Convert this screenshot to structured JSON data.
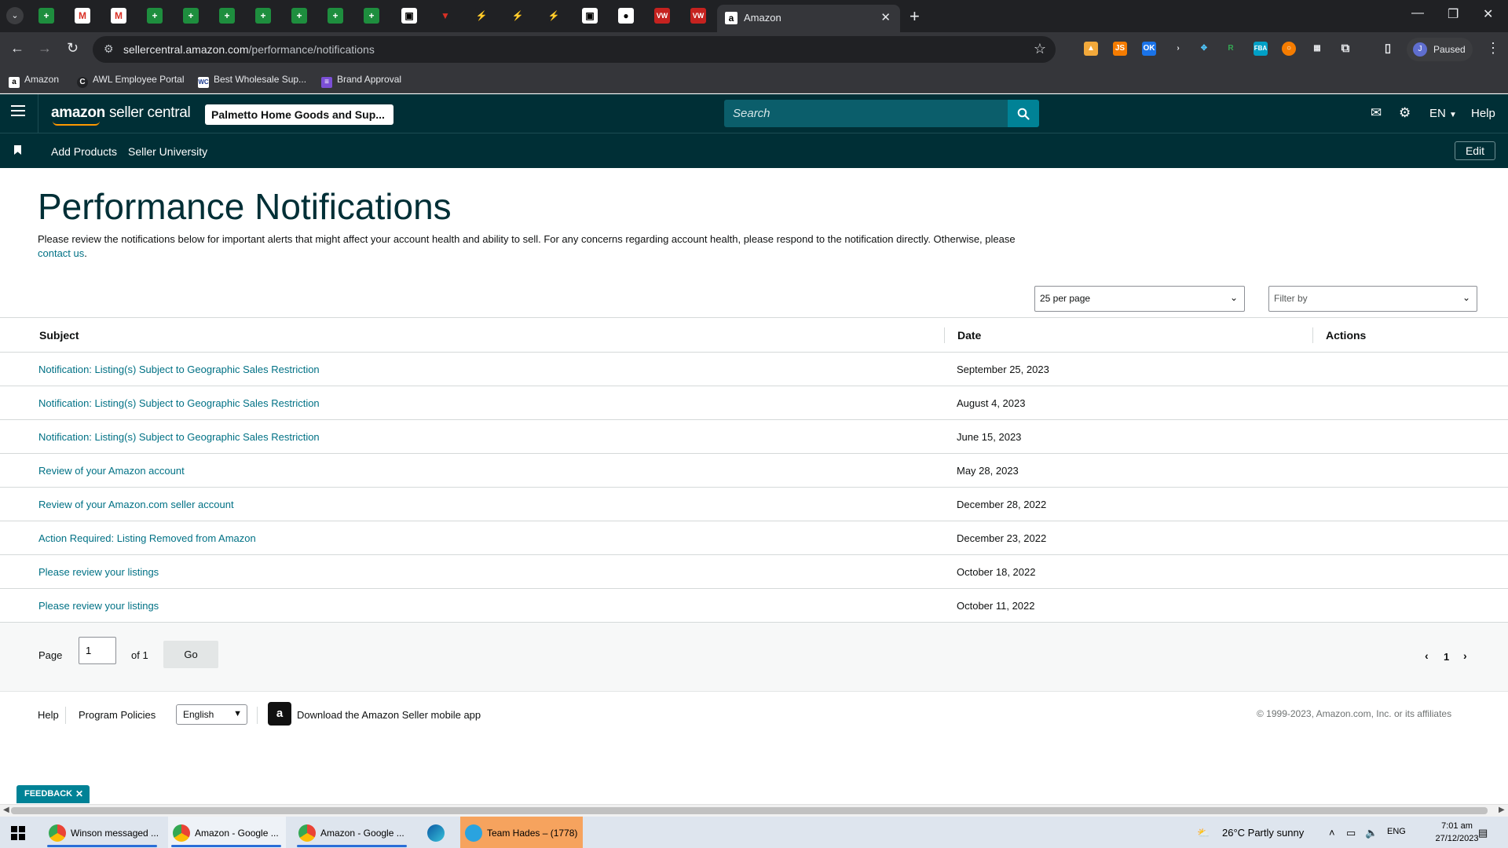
{
  "browser": {
    "active_tab_title": "Amazon",
    "url_domain": "sellercentral.amazon.com",
    "url_path": "/performance/notifications",
    "profile_label": "Paused",
    "profile_initial": "J",
    "bookmarks": [
      "Amazon",
      "AWL Employee Portal",
      "Best Wholesale Sup...",
      "Brand Approval"
    ]
  },
  "header": {
    "logo_brand": "amazon",
    "logo_product": "seller central",
    "store_name": "Palmetto Home Goods and Sup...",
    "search_placeholder": "Search",
    "language": "EN",
    "help": "Help"
  },
  "subnav": {
    "links": [
      "Add Products",
      "Seller University"
    ],
    "edit": "Edit"
  },
  "main": {
    "title": "Performance Notifications",
    "intro_text": "Please review the notifications below for important alerts that might affect your account health and ability to sell. For any concerns regarding account health, please respond to the notification directly. Otherwise, please ",
    "intro_link": "contact us",
    "intro_end": ".",
    "per_page": "25 per page",
    "filter_placeholder": "Filter by"
  },
  "table": {
    "columns": [
      "Subject",
      "Date",
      "Actions"
    ],
    "rows": [
      {
        "subject": "Notification: Listing(s) Subject to Geographic Sales Restriction",
        "date": "September 25, 2023"
      },
      {
        "subject": "Notification: Listing(s) Subject to Geographic Sales Restriction",
        "date": "August 4, 2023"
      },
      {
        "subject": "Notification: Listing(s) Subject to Geographic Sales Restriction",
        "date": "June 15, 2023"
      },
      {
        "subject": "Review of your Amazon account",
        "date": "May 28, 2023"
      },
      {
        "subject": "Review of your Amazon.com seller account",
        "date": "December 28, 2022"
      },
      {
        "subject": "Action Required: Listing Removed from Amazon",
        "date": "December 23, 2022"
      },
      {
        "subject": "Please review your listings",
        "date": "October 18, 2022"
      },
      {
        "subject": "Please review your listings",
        "date": "October 11, 2022"
      }
    ]
  },
  "pagination": {
    "page_label": "Page",
    "page_value": "1",
    "of_label": "of 1",
    "go": "Go",
    "current_page": "1"
  },
  "footer": {
    "help": "Help",
    "program_policies": "Program Policies",
    "language": "English",
    "app_download": "Download the Amazon Seller mobile app",
    "copyright": "© 1999-2023, Amazon.com, Inc. or its affiliates"
  },
  "feedback": "FEEDBACK",
  "taskbar": {
    "items": [
      "Winson messaged ...",
      "Amazon - Google ...",
      "Amazon - Google ...",
      "Team Hades – (1778)"
    ],
    "weather": "26°C  Partly sunny",
    "lang": "ENG",
    "time": "7:01 am",
    "date": "27/12/2023"
  },
  "colors": {
    "header_bg": "#002f36",
    "link": "#007185",
    "search_btn": "#008296",
    "accent": "#ff9900"
  }
}
